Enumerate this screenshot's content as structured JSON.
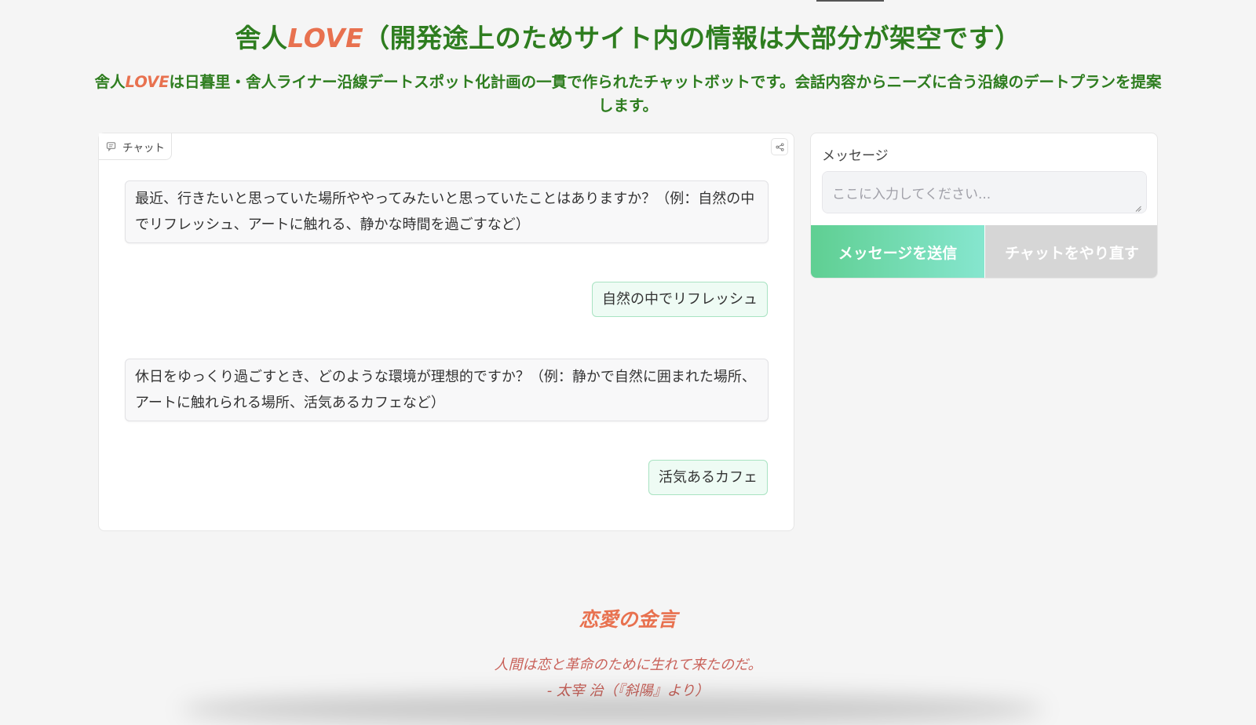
{
  "header": {
    "title_prefix": "舎人",
    "title_brand": "LOVE",
    "title_suffix": "（開発途上のためサイト内の情報は大部分が架空です）",
    "subtitle_prefix": "舎人",
    "subtitle_brand": "LOVE",
    "subtitle_suffix": "は日暮里・舎人ライナー沿線デートスポット化計画の一貫で作られたチャットボットです。会話内容からニーズに合う沿線のデートプランを提案します。"
  },
  "chat": {
    "tab_label": "チャット",
    "messages": [
      {
        "role": "bot",
        "text": "最近、行きたいと思っていた場所ややってみたいと思っていたことはありますか？（例：自然の中でリフレッシュ、アートに触れる、静かな時間を過ごすなど）"
      },
      {
        "role": "user",
        "text": "自然の中でリフレッシュ"
      },
      {
        "role": "bot",
        "text": "休日をゆっくり過ごすとき、どのような環境が理想的ですか？（例：静かで自然に囲まれた場所、アートに触れられる場所、活気あるカフェなど）"
      },
      {
        "role": "user",
        "text": "活気あるカフェ"
      }
    ]
  },
  "input": {
    "label": "メッセージ",
    "placeholder": "ここに入力してください...",
    "send_label": "メッセージを送信",
    "reset_label": "チャットをやり直す"
  },
  "quote": {
    "heading": "恋愛の金言",
    "text": "人間は恋と革命のために生れて来たのだ。",
    "author": "- 太宰 治（『斜陽』より）"
  },
  "colors": {
    "brand_green": "#2e7d1f",
    "accent_orange": "#e8714f",
    "send_gradient_start": "#5fcf92",
    "send_gradient_end": "#86e6cf"
  }
}
